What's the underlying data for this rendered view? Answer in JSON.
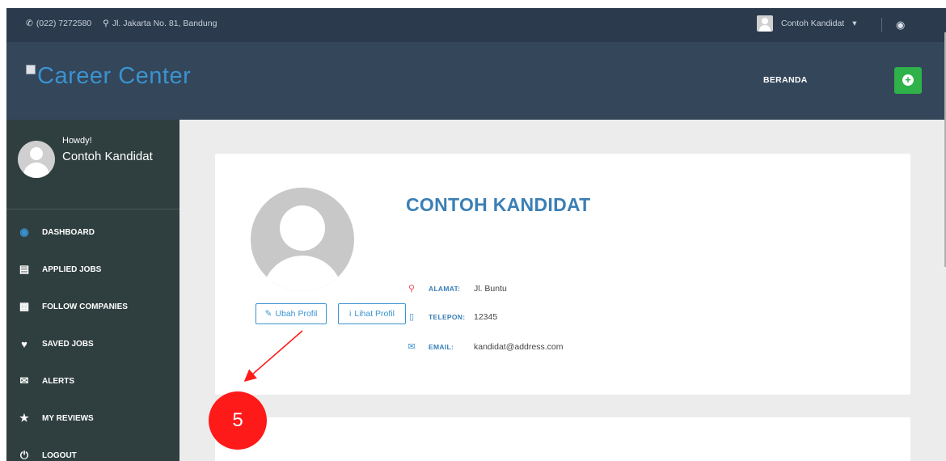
{
  "topbar": {
    "phone": "(022) 7272580",
    "address": "Jl. Jakarta No. 81, Bandung",
    "user_name": "Contoh Kandidat",
    "user_caret": "▾"
  },
  "header": {
    "logo_text": "Career Center",
    "nav_beranda": "BERANDA",
    "plus_symbol": "+"
  },
  "sidebar": {
    "howdy": "Howdy!",
    "name": "Contoh Kandidat",
    "items": [
      {
        "label": "DASHBOARD",
        "icon": "headset-icon"
      },
      {
        "label": "APPLIED JOBS",
        "icon": "id-card-icon"
      },
      {
        "label": "FOLLOW COMPANIES",
        "icon": "briefcase-icon"
      },
      {
        "label": "SAVED JOBS",
        "icon": "heart-icon"
      },
      {
        "label": "ALERTS",
        "icon": "envelope-icon"
      },
      {
        "label": "MY REVIEWS",
        "icon": "star-icon"
      },
      {
        "label": "LOGOUT",
        "icon": "power-icon"
      }
    ]
  },
  "profile": {
    "name": "CONTOH KANDIDAT",
    "ubah_label": "Ubah Profil",
    "lihat_label": "Lihat Profil",
    "alamat_label": "ALAMAT:",
    "alamat_value": "Jl. Buntu",
    "telepon_label": "TELEPON:",
    "telepon_value": "12345",
    "email_label": "EMAIL:",
    "email_value": "kandidat@address.com"
  },
  "annotation": {
    "step_number": "5",
    "color": "#ff1a1a"
  },
  "colors": {
    "accent": "#3a93d0",
    "header_bg": "#34465a",
    "sidebar_bg": "#2f3e3f",
    "add_button": "#2fb24a"
  }
}
